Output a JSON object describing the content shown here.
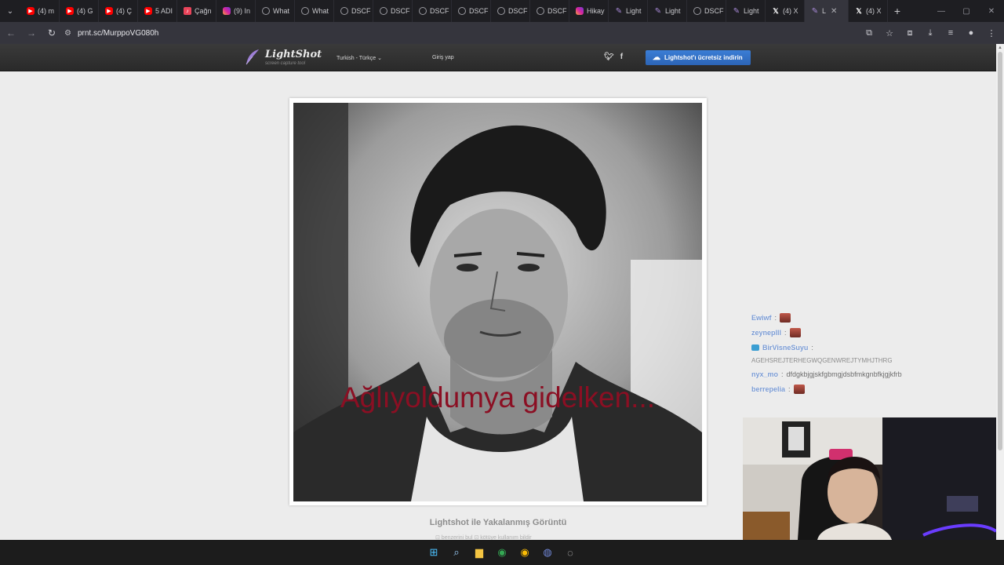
{
  "browser": {
    "tabs": [
      {
        "icon": "youtube-icon",
        "label": "(4) m"
      },
      {
        "icon": "youtube-icon",
        "label": "(4) G"
      },
      {
        "icon": "youtube-icon",
        "label": "(4) Ç"
      },
      {
        "icon": "youtube-icon",
        "label": "5 ADI"
      },
      {
        "icon": "music-icon",
        "label": "Çağn"
      },
      {
        "icon": "instagram-icon",
        "label": "(9) In"
      },
      {
        "icon": "globe-icon",
        "label": "What"
      },
      {
        "icon": "globe-icon",
        "label": "What"
      },
      {
        "icon": "globe-icon",
        "label": "DSCF"
      },
      {
        "icon": "globe-icon",
        "label": "DSCF"
      },
      {
        "icon": "globe-icon",
        "label": "DSCF"
      },
      {
        "icon": "globe-icon",
        "label": "DSCF"
      },
      {
        "icon": "globe-icon",
        "label": "DSCF"
      },
      {
        "icon": "globe-icon",
        "label": "DSCF"
      },
      {
        "icon": "instagram-icon",
        "label": "Hikay"
      },
      {
        "icon": "lightshot-icon",
        "label": "Light"
      },
      {
        "icon": "lightshot-icon",
        "label": "Light"
      },
      {
        "icon": "globe-icon",
        "label": "DSCF"
      },
      {
        "icon": "lightshot-icon",
        "label": "Light"
      },
      {
        "icon": "x-icon",
        "label": "(4) X"
      },
      {
        "icon": "lightshot-icon",
        "label": "L",
        "active": true
      },
      {
        "icon": "x-icon",
        "label": "(4) X"
      }
    ],
    "url": "prnt.sc/MurppoVG080h"
  },
  "lightshot": {
    "logo_name": "LightShot",
    "logo_tagline": "screen capture tool",
    "language": "Turkish - Türkçe",
    "login_label": "Giriş yap",
    "download_label": "Lightshot'ı ücretsiz indirin",
    "image_caption": "Ağlıyoldumya gidelken...",
    "page_title": "Lightshot ile Yakalanmış Görüntü",
    "footer_links": "⊡ benzerini bul  ⊡ kötüye kullanım bildir"
  },
  "chat": [
    {
      "user": "Ewiwf",
      "sep": " : ",
      "emote": true
    },
    {
      "user": "zeyneplll",
      "sep": " : ",
      "emote": true
    },
    {
      "user": "BirVisneSuyu",
      "sep": " :",
      "badge": true
    },
    {
      "message": "AGEHSREJTERHEGWQGENWREJTYMHJTHRG"
    },
    {
      "user": "nyx_mo",
      "sep": " : ",
      "text": "dfdgkbjgjskfgbmgjdsbfmkgnbfkjgjkfrb"
    },
    {
      "user": "berrepelia",
      "sep": " : ",
      "emote": true
    }
  ],
  "colors": {
    "caption": "#8b0f23",
    "download_button": "#3b7ed6",
    "chat_user": "#7a9bd4"
  }
}
